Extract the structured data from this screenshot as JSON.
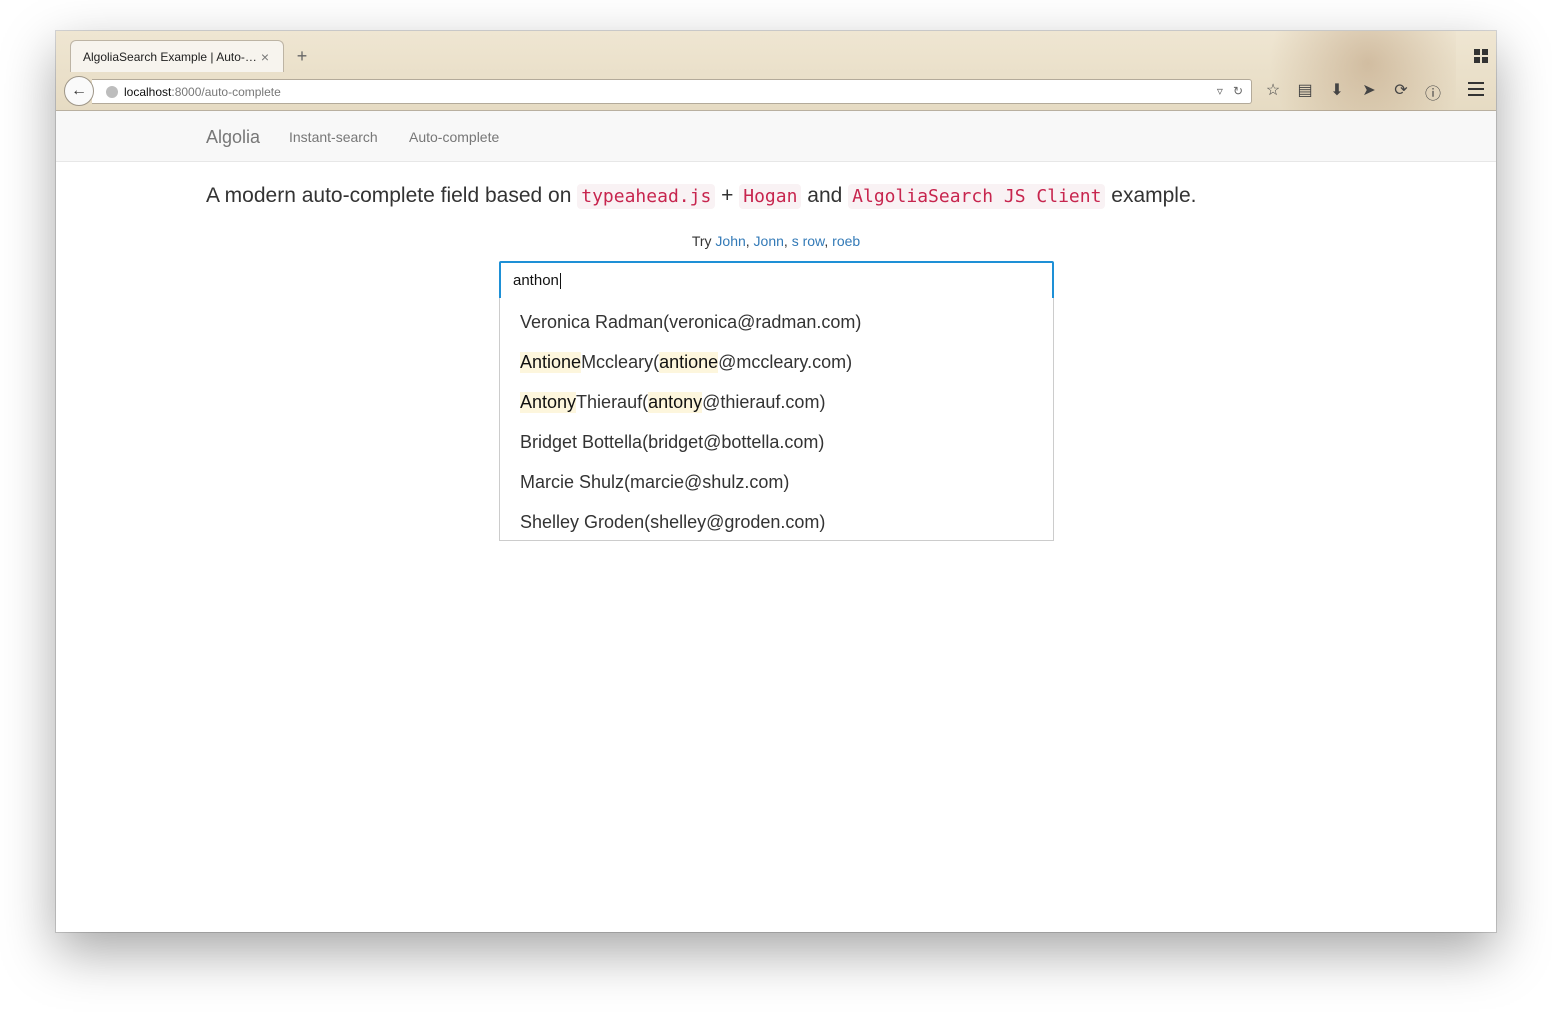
{
  "browser": {
    "tab_title": "AlgoliaSearch Example | Auto-c...",
    "tab_close": "×",
    "new_tab": "+",
    "url_host": "localhost",
    "url_rest": ":8000/auto-complete",
    "dropdown_glyph": "▿",
    "reload_glyph": "↻",
    "back_glyph": "←",
    "toolbar": [
      "☆",
      "▤",
      "⬇",
      "➤",
      "⟳",
      "ⓘ"
    ]
  },
  "navbar": {
    "brand": "Algolia",
    "links": [
      "Instant-search",
      "Auto-complete"
    ]
  },
  "headline": {
    "part1": "A modern auto-complete field based on",
    "code1": "typeahead.js",
    "plus": "+",
    "code2": "Hogan",
    "and": "and",
    "code3": "AlgoliaSearch JS Client",
    "part2": "example."
  },
  "try": {
    "prefix": "Try",
    "links": [
      "John",
      "Jonn",
      "s row",
      "roeb"
    ]
  },
  "search": {
    "value": "anthon"
  },
  "suggestions": [
    [
      {
        "t": "Veronica Radman(veronica@radman.com)",
        "h": false
      }
    ],
    [
      {
        "t": "Antione",
        "h": true
      },
      {
        "t": " Mccleary(",
        "h": false
      },
      {
        "t": "antione",
        "h": true
      },
      {
        "t": "@mccleary.com)",
        "h": false
      }
    ],
    [
      {
        "t": "Antony",
        "h": true
      },
      {
        "t": " Thierauf(",
        "h": false
      },
      {
        "t": "antony",
        "h": true
      },
      {
        "t": "@thierauf.com)",
        "h": false
      }
    ],
    [
      {
        "t": "Bridget Bottella(bridget@bottella.com)",
        "h": false
      }
    ],
    [
      {
        "t": "Marcie Shulz(marcie@shulz.com)",
        "h": false
      }
    ],
    [
      {
        "t": "Shelley Groden(shelley@groden.com)",
        "h": false
      }
    ]
  ],
  "colors": {
    "accent": "#1e90d6",
    "link": "#337ab7",
    "code": "#c7254e",
    "highlight": "#fdf6dd"
  }
}
